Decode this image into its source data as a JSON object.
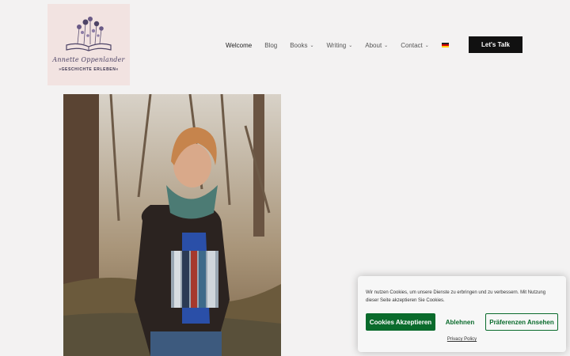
{
  "logo": {
    "script_name": "Annette Oppenlander",
    "tagline": "»GESCHICHTE ERLEBEN«"
  },
  "nav": {
    "items": [
      {
        "label": "Welcome",
        "has_dropdown": false
      },
      {
        "label": "Blog",
        "has_dropdown": false
      },
      {
        "label": "Books",
        "has_dropdown": true
      },
      {
        "label": "Writing",
        "has_dropdown": true
      },
      {
        "label": "About",
        "has_dropdown": true
      },
      {
        "label": "Contact",
        "has_dropdown": true
      }
    ],
    "language_flag": "de-flag-icon",
    "cta_label": "Let's Talk"
  },
  "hero": {
    "photo": "author-holding-books-photo"
  },
  "cookie_banner": {
    "text": "Wir nutzen Cookies, um unsere Dienste zu erbringen und zu verbessern. Mit Nutzung dieser Seite akzeptieren Sie Cookies.",
    "accept_label": "Cookies Akzeptieren",
    "deny_label": "Ablehnen",
    "prefs_label": "Präferenzen Ansehen",
    "privacy_label": "Privacy Policy",
    "accent_color": "#0a6b2c"
  }
}
